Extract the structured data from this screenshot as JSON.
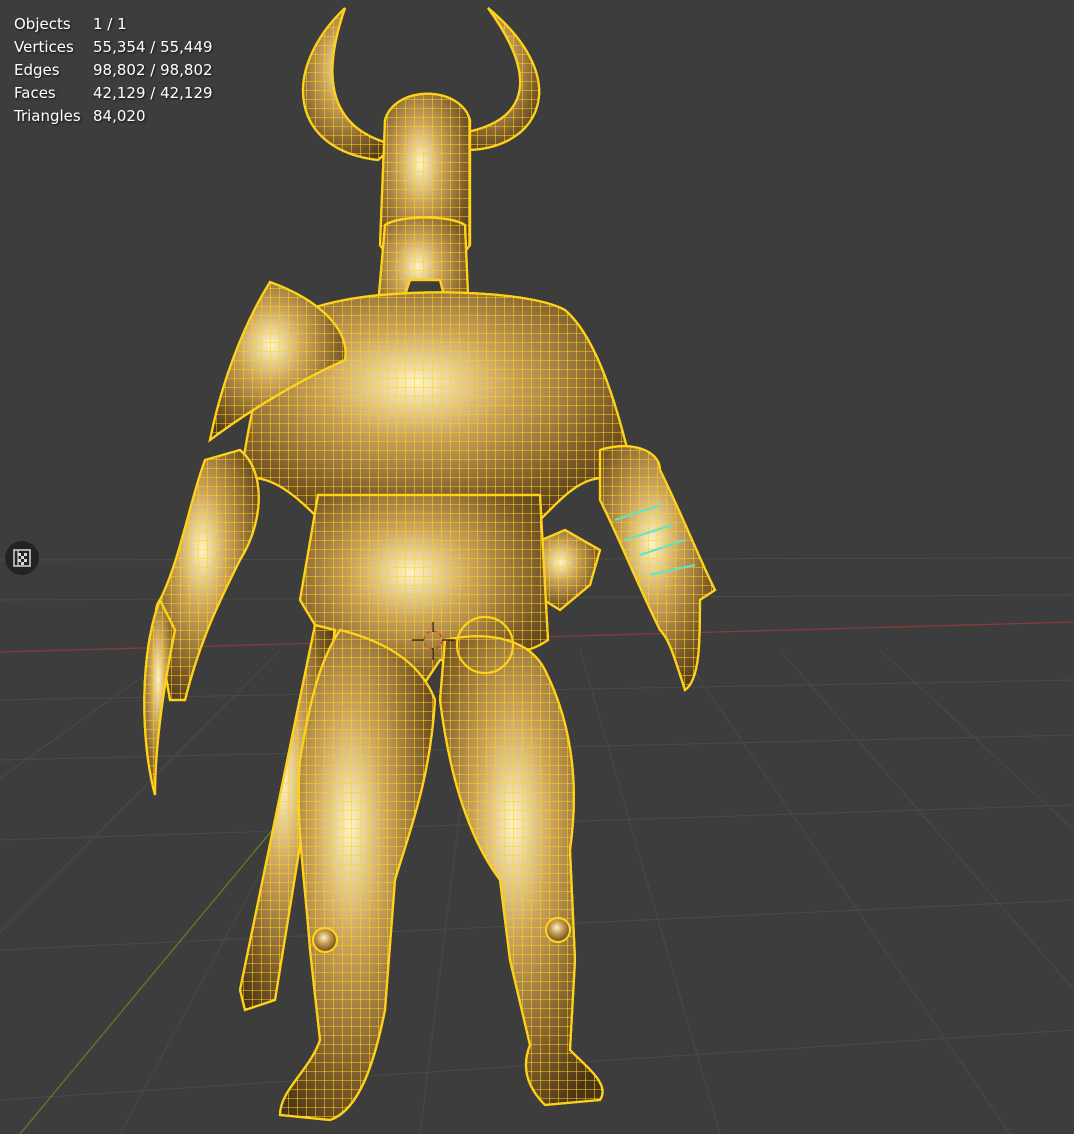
{
  "viewport": {
    "background": "#3d3d3d",
    "grid_color": "#4a4a4a",
    "x_axis_color": "#8a3a3a",
    "y_axis_color": "#5e7d2a",
    "wire_color": "#ffd21a",
    "selected_edge_color": "#5fe6c8"
  },
  "stats": {
    "objects_label": "Objects",
    "objects_value": "1 / 1",
    "vertices_label": "Vertices",
    "vertices_value": "55,354 / 55,449",
    "edges_label": "Edges",
    "edges_value": "98,802 / 98,802",
    "faces_label": "Faces",
    "faces_value": "42,129 / 42,129",
    "triangles_label": "Triangles",
    "triangles_value": "84,020"
  },
  "toolbar": {
    "toggle_icon": "checker-grid-icon"
  }
}
